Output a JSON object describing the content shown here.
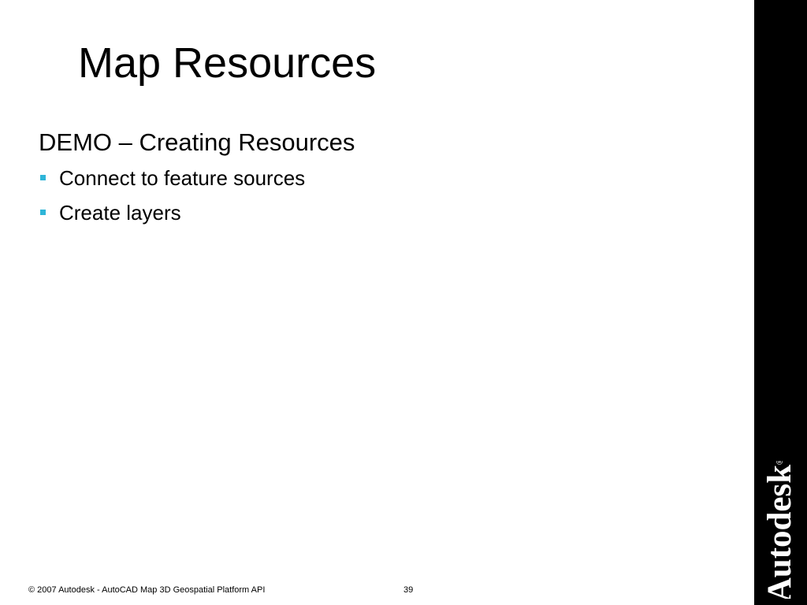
{
  "slide": {
    "title": "Map Resources",
    "heading": "DEMO – Creating Resources",
    "bullets": [
      {
        "text": "Connect to feature sources"
      },
      {
        "text": "Create layers"
      }
    ],
    "bullet_color": "#2eb5d8"
  },
  "sidebar": {
    "logo_text": "Autodesk",
    "logo_registered": "®",
    "background_color": "#000000"
  },
  "footer": {
    "copyright": "© 2007 Autodesk - AutoCAD Map 3D Geospatial Platform API",
    "page_number": "39"
  }
}
